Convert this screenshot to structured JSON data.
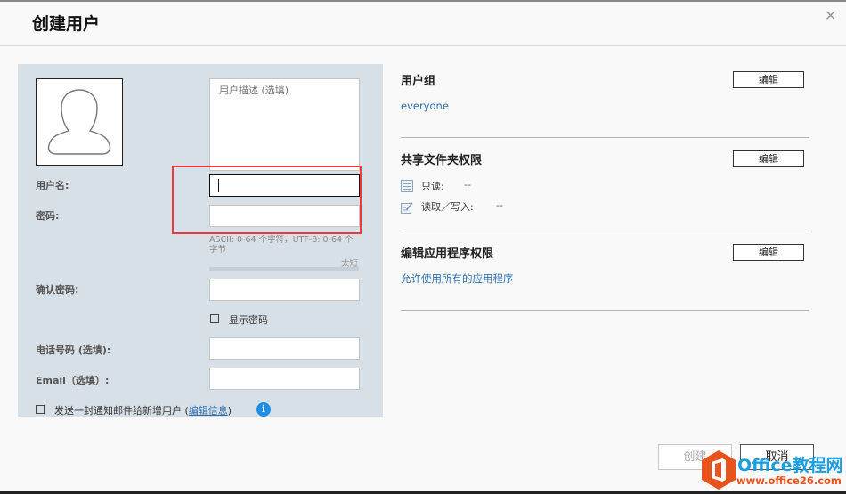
{
  "dialog": {
    "title": "创建用户",
    "close_icon": "close-icon"
  },
  "form": {
    "description_placeholder": "用户描述 (选填)",
    "username_label": "用户名:",
    "username_value": "",
    "password_label": "密码:",
    "password_value": "",
    "password_hint": "ASCII: 0-64 个字符，UTF-8: 0-64 个字节",
    "password_strength": "太短",
    "password_strength_fraction": 0,
    "confirm_label": "确认密码:",
    "show_password_label": "显示密码",
    "show_password_checked": false,
    "phone_label": "电话号码 (选填):",
    "email_label": "Email（选填）:",
    "notify_label": "发送一封通知邮件给新增用户 (",
    "notify_link": "编辑信息",
    "notify_suffix": ")",
    "notify_checked": false,
    "info_icon_glyph": "i"
  },
  "right": {
    "user_group": {
      "title": "用户组",
      "edit_label": "编辑",
      "value": "everyone"
    },
    "shared_folder": {
      "title": "共享文件夹权限",
      "edit_label": "编辑",
      "read_only_label": "只读:",
      "read_only_value": "--",
      "read_write_label": "读取／写入:",
      "read_write_value": "--"
    },
    "app_permission": {
      "title": "编辑应用程序权限",
      "edit_label": "编辑",
      "value": "允许使用所有的应用程序"
    }
  },
  "footer": {
    "create_label": "创建",
    "cancel_label": "取消"
  },
  "watermark": {
    "line1": "Office教程网",
    "line2": "www.office26.com"
  },
  "colors": {
    "accent_link": "#2b6fae",
    "highlight_box": "#ee3a3a",
    "left_panel_bg": "#d8e0e7"
  }
}
